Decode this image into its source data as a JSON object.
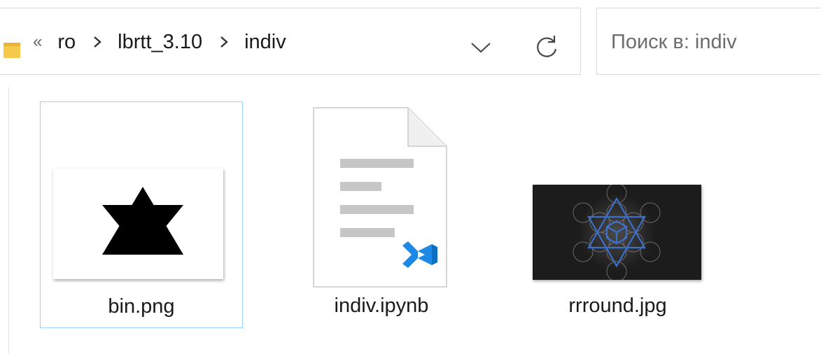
{
  "address_bar": {
    "overflow_glyph": "«",
    "breadcrumbs": [
      "ro",
      "lbrtt_3.10",
      "indiv"
    ]
  },
  "search": {
    "placeholder": "Поиск в: indiv",
    "value": ""
  },
  "icons": {
    "folder": "folder-icon",
    "dropdown": "chevron-down-icon",
    "refresh": "refresh-icon",
    "breadcrumb_separator": "chevron-right-icon"
  },
  "files": [
    {
      "name": "bin.png",
      "kind": "image-thumbnail",
      "selected": true
    },
    {
      "name": "indiv.ipynb",
      "kind": "vscode-document",
      "selected": false
    },
    {
      "name": "rrround.jpg",
      "kind": "image-thumbnail",
      "selected": false
    }
  ],
  "colors": {
    "selection_border": "#99d1ff",
    "vscode_blue": "#1e88e5",
    "folder_yellow": "#f6c94a"
  }
}
